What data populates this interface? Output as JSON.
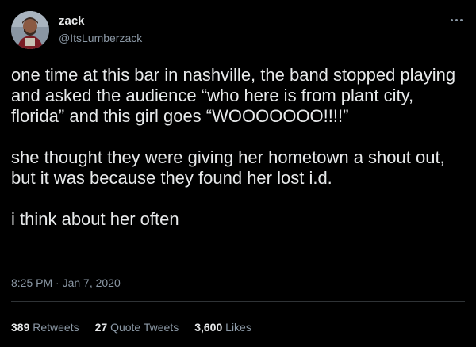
{
  "author": {
    "name": "zack",
    "handle": "@ItsLumberzack"
  },
  "icons": {
    "more": "more-horizontal-icon",
    "avatar": "profile-avatar"
  },
  "tweet": {
    "paragraphs": [
      "one time at this bar in nashville, the band stopped playing and asked the audience “who here is from plant city, florida” and this girl goes “WOOOOOOO!!!!”",
      "she thought they were giving her hometown a shout out, but it was because they found her lost i.d.",
      "i think about her often"
    ],
    "timestamp": "8:25 PM · Jan 7, 2020"
  },
  "stats": {
    "retweets": {
      "count": "389",
      "label": "Retweets"
    },
    "quote_tweets": {
      "count": "27",
      "label": "Quote Tweets"
    },
    "likes": {
      "count": "3,600",
      "label": "Likes"
    }
  },
  "colors": {
    "background": "#000000",
    "text": "#e7e9ea",
    "secondary": "#8b98a5",
    "divider": "#2f3336"
  }
}
